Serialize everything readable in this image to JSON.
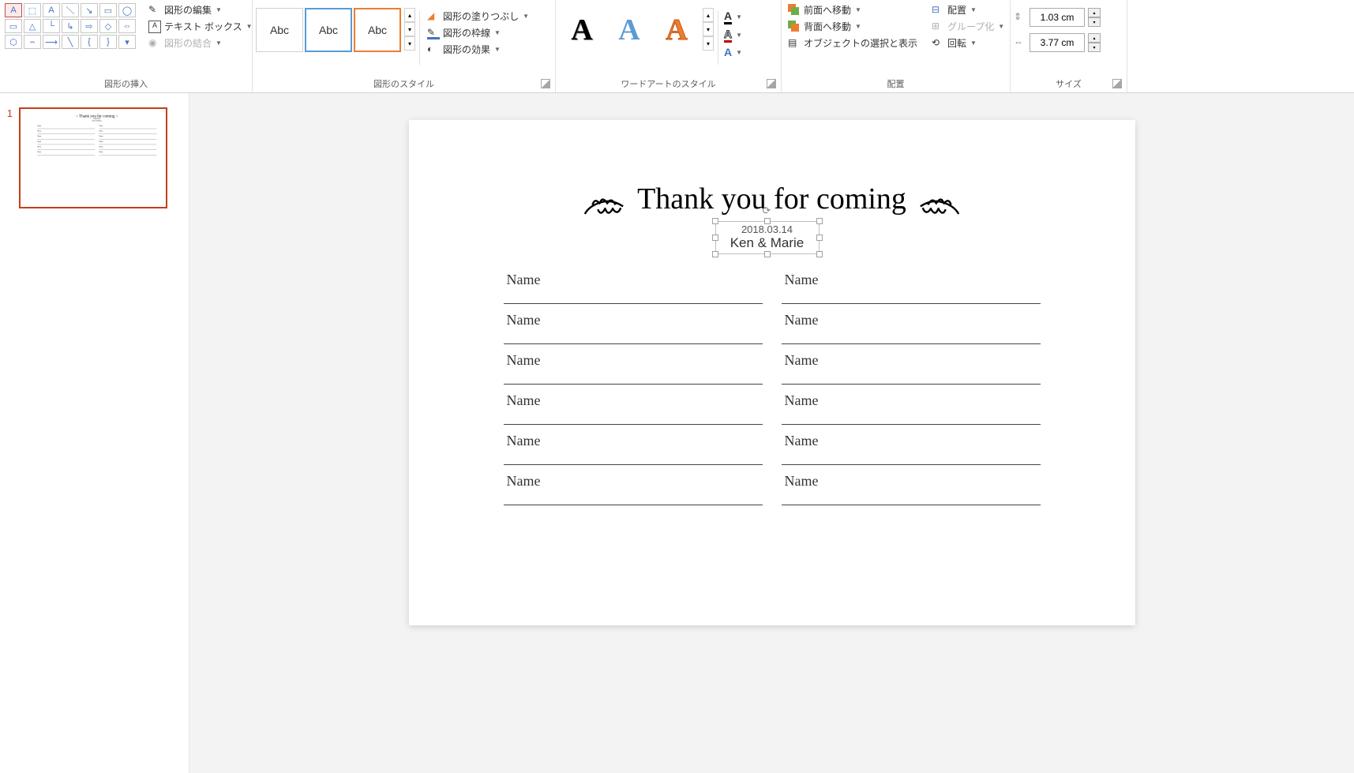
{
  "ribbon": {
    "groups": {
      "insert_shapes": "図形の挿入",
      "shape_styles": "図形のスタイル",
      "wordart_styles": "ワードアートのスタイル",
      "arrange": "配置",
      "size": "サイズ"
    },
    "commands": {
      "edit_shape": "図形の編集",
      "text_box": "テキスト ボックス",
      "merge_shapes": "図形の結合",
      "shape_fill": "図形の塗りつぶし",
      "shape_outline": "図形の枠線",
      "shape_effects": "図形の効果",
      "bring_forward": "前面へ移動",
      "send_backward": "背面へ移動",
      "selection_pane": "オブジェクトの選択と表示",
      "align": "配置",
      "group": "グループ化",
      "rotate": "回転"
    },
    "style_label": "Abc",
    "size_values": {
      "height": "1.03 cm",
      "width": "3.77 cm"
    }
  },
  "slide_panel": {
    "slide_number": "1"
  },
  "slide_content": {
    "title": "Thank you for coming",
    "date": "2018.03.14",
    "names": "Ken & Marie",
    "name_label": "Name"
  }
}
